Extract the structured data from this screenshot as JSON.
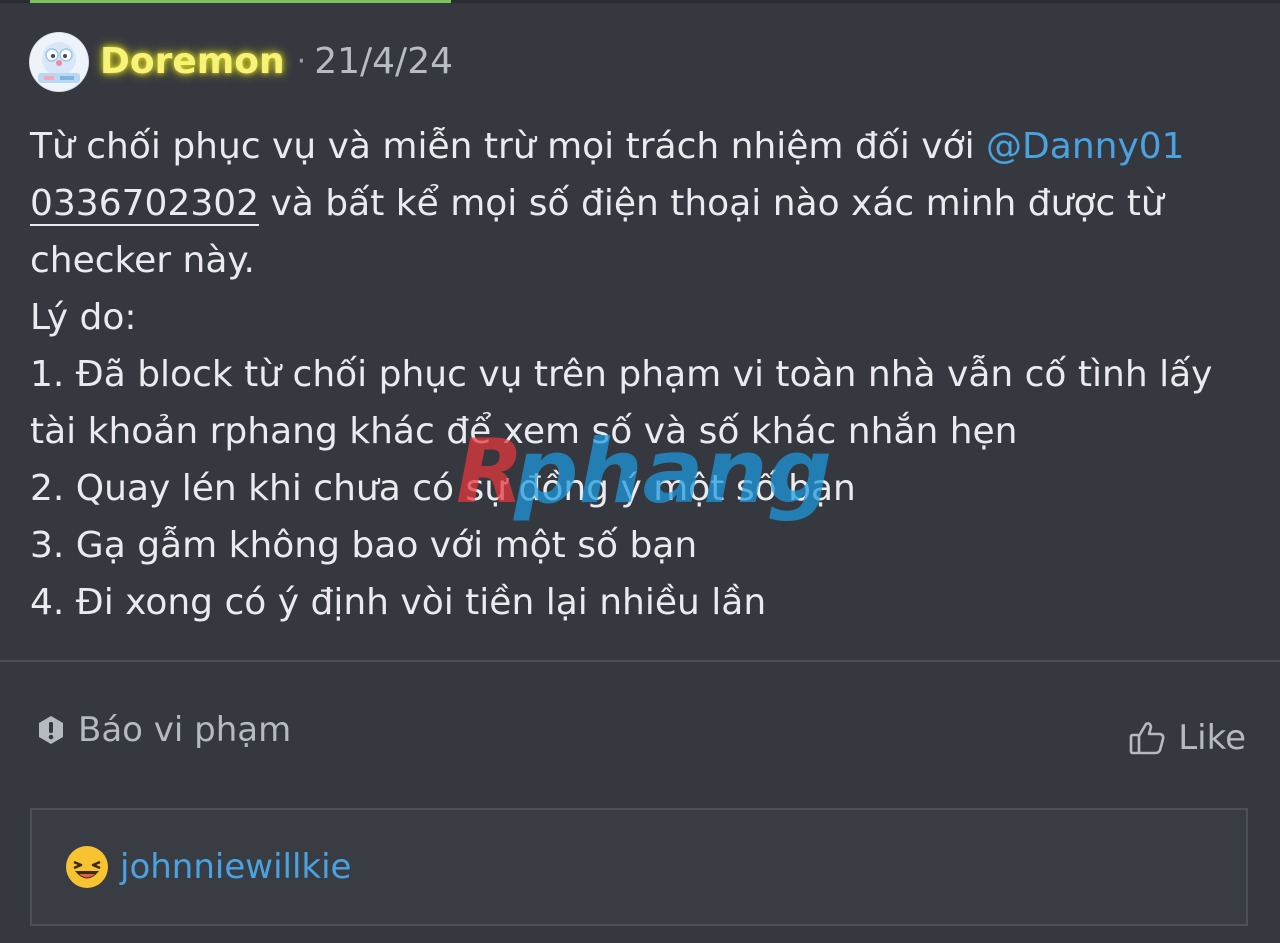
{
  "post": {
    "author": "Doremon",
    "separator": "·",
    "date": "21/4/24",
    "body": {
      "line1_text": "Từ chối phục vụ và miễn trừ mọi trách nhiệm đối với ",
      "line1_mention": "@Danny01",
      "line2_phone": "0336702302",
      "line2_text": " và bất kể mọi số điện thoại nào xác minh được từ",
      "line3": "checker này.",
      "line4": "Lý do:",
      "line5": "1. Đã block từ chối phục vụ trên phạm vi toàn nhà vẫn cố tình lấy",
      "line6": "tài khoản rphang khác để xem số và số khác nhắn hẹn",
      "line7": "2. Quay lén khi chưa có sự đồng ý một số bạn",
      "line8": "3. Gạ gẫm không bao với một số bạn",
      "line9": "4. Đi xong có ý định vòi tiền lại nhiều lần"
    },
    "watermark": "Rphang"
  },
  "actions": {
    "report_label": "Báo vi phạm",
    "report_icon": "exclamation-circle-icon",
    "like_label": "Like",
    "like_icon": "thumbs-up-icon"
  },
  "reactions": {
    "emoji_icon": "laughing-emoji-icon",
    "users": [
      "johnniewillkie"
    ]
  },
  "colors": {
    "background": "#35383f",
    "author": "#f6f27a",
    "mention": "#4aa3e0",
    "progress": "#7bc35a",
    "watermark_red": "#e8383d",
    "watermark_blue": "#1e9be0"
  }
}
